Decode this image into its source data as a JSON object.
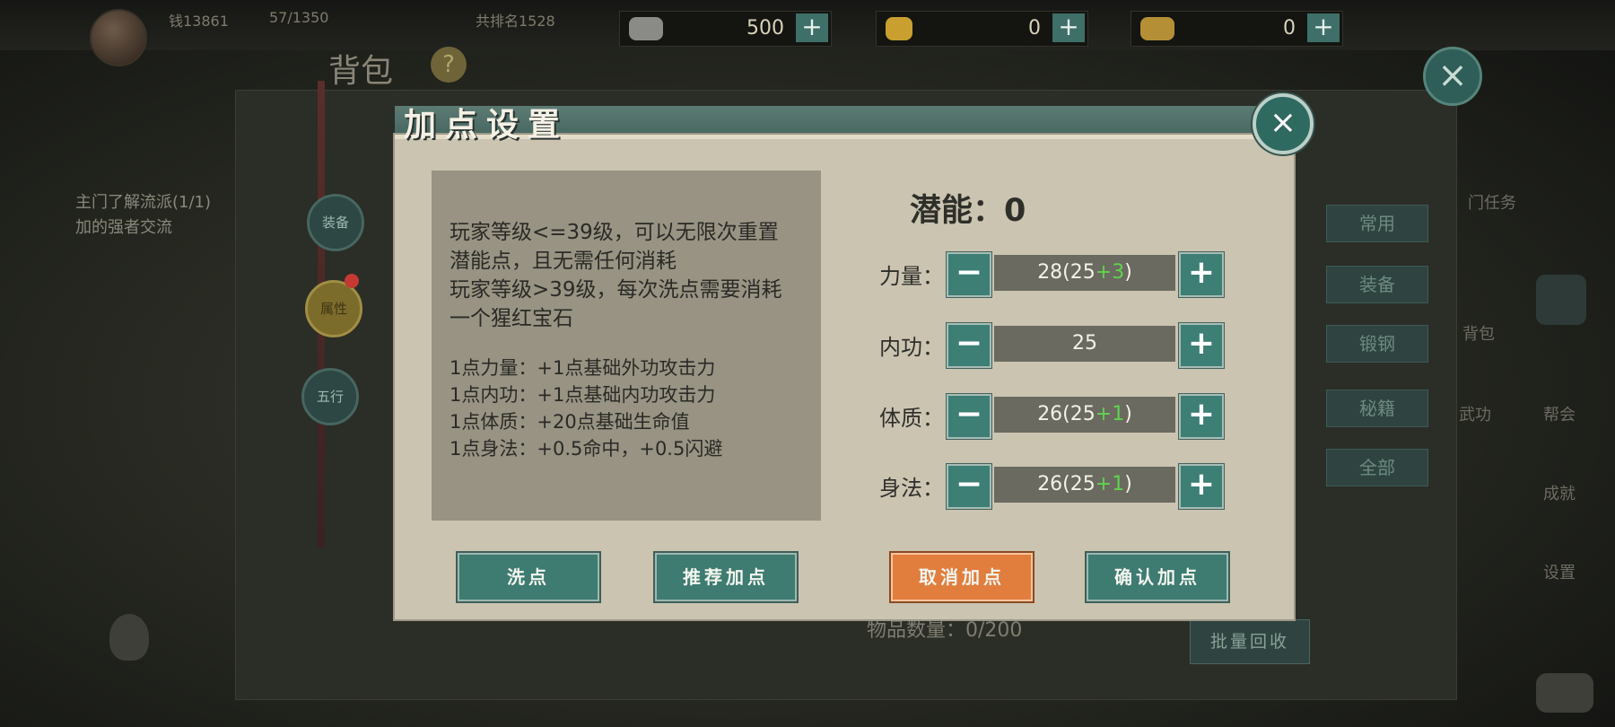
{
  "background": {
    "top_stats": [
      "钱13861",
      "57/1350",
      "",
      "共排名1528"
    ],
    "resources": [
      {
        "icon": "silver-ingot-icon",
        "value": "500"
      },
      {
        "icon": "gold-bar-icon",
        "value": "0"
      },
      {
        "icon": "gold-ingot-icon",
        "value": "0"
      }
    ],
    "bag_title": "背包",
    "help_icon": "?",
    "quest_text": [
      "主门了解流派(1/1)",
      "加的强者交流"
    ],
    "side_tabs": [
      "装备",
      "属性",
      "五行"
    ],
    "categories": [
      "常用",
      "装备",
      "锻钢",
      "秘籍",
      "全部"
    ],
    "right_col_labels": [
      "背包",
      "武功",
      "帮会",
      "成就",
      "设置",
      "门任务"
    ],
    "item_count": "物品数量：0/200",
    "bulk_recycle": "批量回收"
  },
  "dialog": {
    "title": "加点设置",
    "close_icon": "×",
    "info_paragraph_1": [
      "玩家等级<=39级，可以无限次重置",
      "潜能点，且无需任何消耗",
      "玩家等级>39级，每次洗点需要消耗",
      "一个猩红宝石"
    ],
    "info_paragraph_2": [
      "1点力量：+1点基础外功攻击力",
      "1点内功：+1点基础内功攻击力",
      "1点体质：+20点基础生命值",
      "1点身法：+0.5命中，+0.5闪避"
    ],
    "potential": "潜能：0",
    "stats": [
      {
        "label": "力量：",
        "main": "28(25",
        "bonus": "+3",
        "close": ")"
      },
      {
        "label": "内功：",
        "main": "25",
        "bonus": "",
        "close": ""
      },
      {
        "label": "体质：",
        "main": "26(25",
        "bonus": "+1",
        "close": ")"
      },
      {
        "label": "身法：",
        "main": "26(25",
        "bonus": "+1",
        "close": ")"
      }
    ],
    "minus_symbol": "−",
    "plus_symbol": "+",
    "buttons": {
      "reset": "洗点",
      "recommend": "推荐加点",
      "cancel": "取消加点",
      "confirm": "确认加点"
    },
    "colors": {
      "bonus": "#5fd34f",
      "cancel_button": "#e17e3e",
      "teal_button": "#3e7b70"
    }
  }
}
